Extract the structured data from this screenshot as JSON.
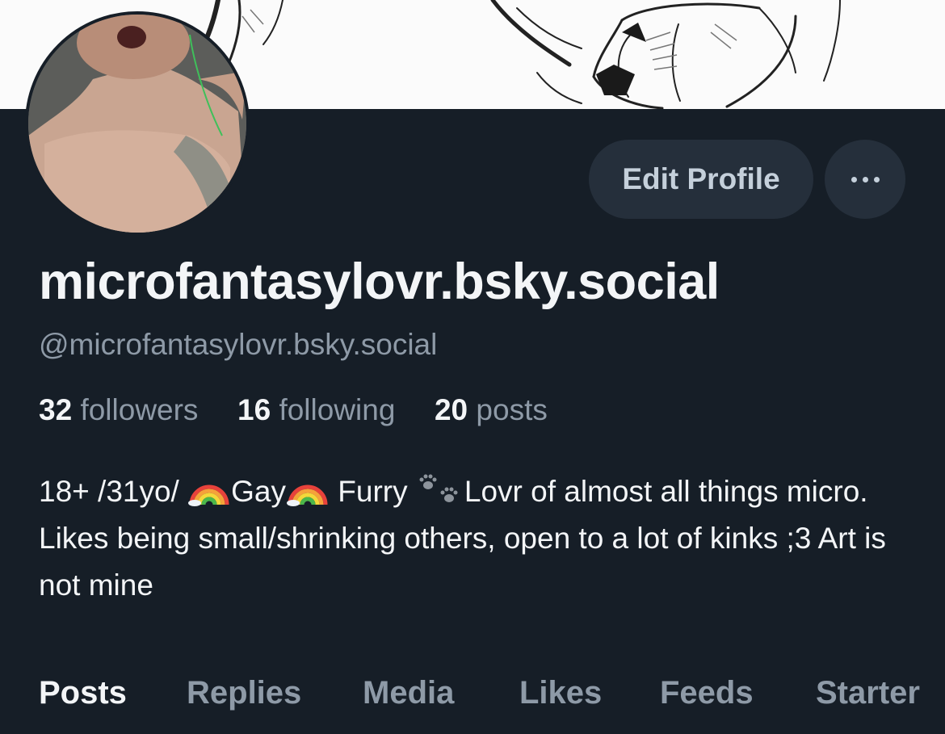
{
  "profile": {
    "display_name": "microfantasylovr.bsky.social",
    "handle": "@microfantasylovr.bsky.social",
    "edit_button_label": "Edit Profile",
    "more_icon": "more-horizontal-icon"
  },
  "stats": {
    "followers_count": "32",
    "followers_label": "followers",
    "following_count": "16",
    "following_label": "following",
    "posts_count": "20",
    "posts_label": "posts"
  },
  "bio": {
    "part1": "18+ /31yo/ ",
    "part2": "Gay",
    "part3": " Furry ",
    "part4": "Lovr of almost all things micro. Likes being small/shrinking others, open to a lot of kinks ;3 Art is not mine",
    "emoji_rainbow": "rainbow-emoji",
    "emoji_paws": "paw-prints-emoji"
  },
  "tabs": [
    {
      "label": "Posts",
      "active": true
    },
    {
      "label": "Replies",
      "active": false
    },
    {
      "label": "Media",
      "active": false
    },
    {
      "label": "Likes",
      "active": false
    },
    {
      "label": "Feeds",
      "active": false
    },
    {
      "label": "Starter",
      "active": false
    }
  ],
  "colors": {
    "background": "#161e27",
    "button_bg": "#252f3b",
    "text_primary": "#f3f5f7",
    "text_secondary": "#8e9aa7"
  }
}
